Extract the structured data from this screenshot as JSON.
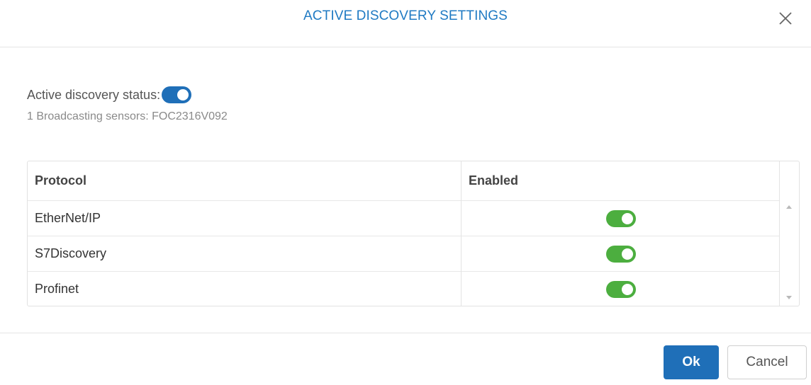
{
  "dialog": {
    "title": "ACTIVE DISCOVERY SETTINGS",
    "close_icon": "close-icon"
  },
  "status": {
    "label": "Active discovery status:",
    "enabled": true,
    "sensors_text": "1 Broadcasting sensors: FOC2316V092"
  },
  "table": {
    "columns": [
      "Protocol",
      "Enabled"
    ],
    "rows": [
      {
        "protocol": "EtherNet/IP",
        "enabled": true
      },
      {
        "protocol": "S7Discovery",
        "enabled": true
      },
      {
        "protocol": "Profinet",
        "enabled": true
      }
    ]
  },
  "footer": {
    "ok_label": "Ok",
    "cancel_label": "Cancel"
  },
  "colors": {
    "accent": "#1f7ac3",
    "toggle_on_green": "#4cae3f",
    "toggle_on_blue": "#1f6fb8"
  }
}
